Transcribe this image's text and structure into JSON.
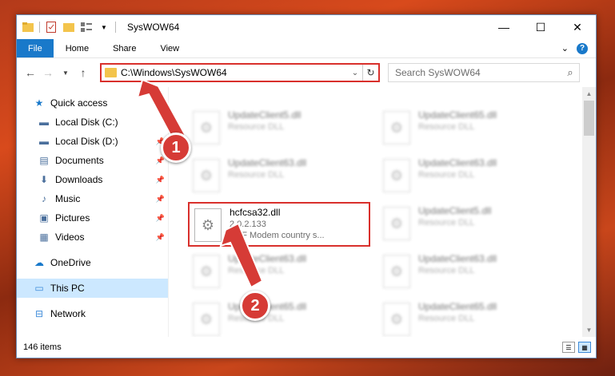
{
  "window": {
    "title": "SysWOW64",
    "controls": {
      "minimize": "—",
      "maximize": "☐",
      "close": "✕"
    }
  },
  "ribbon": {
    "tabs": [
      "File",
      "Home",
      "Share",
      "View"
    ],
    "expand": "⌄",
    "help": "?"
  },
  "address": {
    "path": "C:\\Windows\\SysWOW64",
    "dropdown": "⌄",
    "refresh": "↻"
  },
  "search": {
    "placeholder": "Search SysWOW64",
    "icon": "⌕"
  },
  "nav": {
    "quick_access": "Quick access",
    "items": [
      {
        "label": "Local Disk (C:)",
        "icon": "drive-icon",
        "glyph": "▬",
        "pinned": false
      },
      {
        "label": "Local Disk (D:)",
        "icon": "drive-icon",
        "glyph": "▬",
        "pinned": true
      },
      {
        "label": "Documents",
        "icon": "documents-icon",
        "glyph": "▤",
        "pinned": true
      },
      {
        "label": "Downloads",
        "icon": "downloads-icon",
        "glyph": "⬇",
        "pinned": true
      },
      {
        "label": "Music",
        "icon": "music-icon",
        "glyph": "♪",
        "pinned": true
      },
      {
        "label": "Pictures",
        "icon": "pictures-icon",
        "glyph": "▣",
        "pinned": true
      },
      {
        "label": "Videos",
        "icon": "videos-icon",
        "glyph": "▦",
        "pinned": true
      }
    ],
    "onedrive": "OneDrive",
    "this_pc": "This PC",
    "network": "Network"
  },
  "files": [
    {
      "name": "UpdateClient5.dll",
      "meta1": "Resource DLL",
      "meta2": ""
    },
    {
      "name": "UpdateClient65.dll",
      "meta1": "Resource DLL",
      "meta2": ""
    },
    {
      "name": "UpdateClient63.dll",
      "meta1": "Resource DLL",
      "meta2": ""
    },
    {
      "name": "UpdateClient63.dll",
      "meta1": "Resource DLL",
      "meta2": ""
    },
    {
      "name": "hcfcsa32.dll",
      "meta1": "2.0.2.133",
      "meta2": "HSF Modem country s..."
    },
    {
      "name": "UpdateClient5.dll",
      "meta1": "Resource DLL",
      "meta2": ""
    },
    {
      "name": "UpdateClient63.dll",
      "meta1": "Resource DLL",
      "meta2": ""
    },
    {
      "name": "UpdateClient63.dll",
      "meta1": "Resource DLL",
      "meta2": ""
    },
    {
      "name": "UpdateClient65.dll",
      "meta1": "Resource DLL",
      "meta2": ""
    },
    {
      "name": "UpdateClient65.dll",
      "meta1": "Resource DLL",
      "meta2": ""
    }
  ],
  "status": {
    "count": "146 items"
  },
  "callouts": [
    "1",
    "2"
  ],
  "colors": {
    "accent": "#1979ca",
    "highlight_red": "#d9302c",
    "selected_bg": "#cce8ff"
  }
}
